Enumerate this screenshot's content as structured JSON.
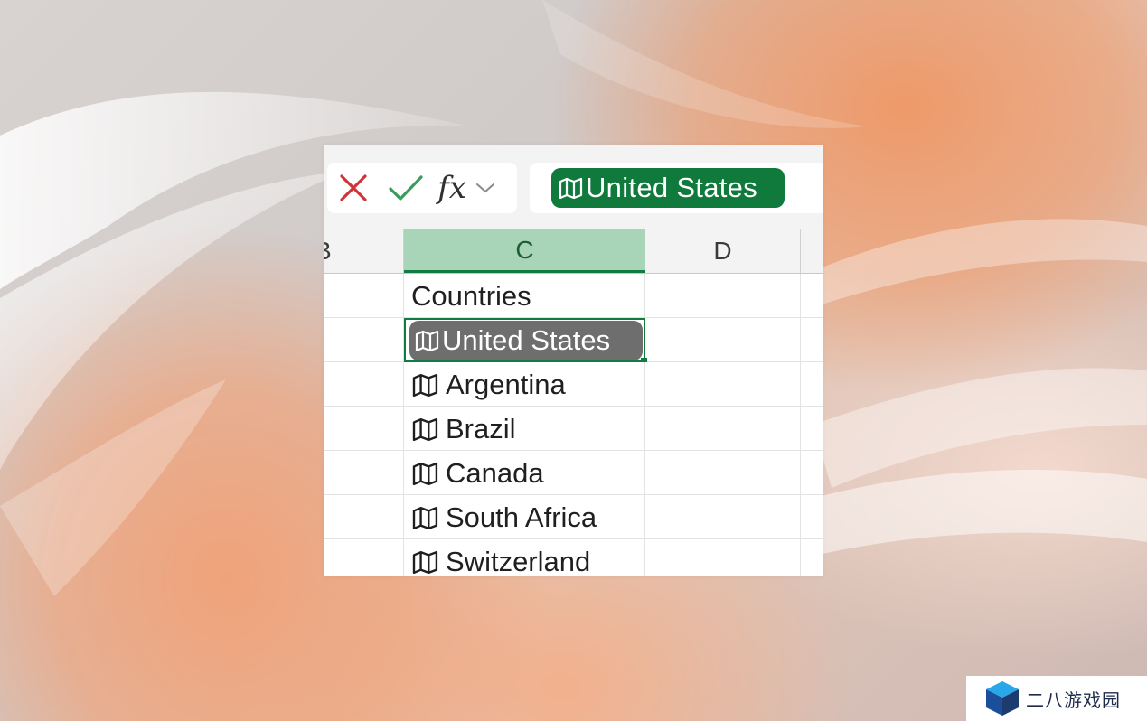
{
  "formula_bar": {
    "cancel_icon": "close-x-icon",
    "enter_icon": "checkmark-icon",
    "function_label": "fx",
    "function_dropdown_icon": "chevron-down-icon",
    "value": "United States",
    "value_icon": "map-icon"
  },
  "columns": [
    {
      "label": "B"
    },
    {
      "label": "C",
      "selected": true
    },
    {
      "label": "D"
    }
  ],
  "cells": {
    "header": "Countries",
    "rows": [
      {
        "text": "United States",
        "icon": "map-icon",
        "selected": true
      },
      {
        "text": "Argentina",
        "icon": "map-icon"
      },
      {
        "text": "Brazil",
        "icon": "map-icon"
      },
      {
        "text": "Canada",
        "icon": "map-icon"
      },
      {
        "text": "South Africa",
        "icon": "map-icon"
      },
      {
        "text": "Switzerland",
        "icon": "map-icon"
      }
    ]
  },
  "colors": {
    "accent_green": "#107c41",
    "selected_header": "#a8d5b7",
    "chip_gray": "#6e6e6e",
    "cancel_red": "#d13438"
  },
  "watermark": {
    "text": "二八游戏园",
    "logo": "cube-logo"
  }
}
